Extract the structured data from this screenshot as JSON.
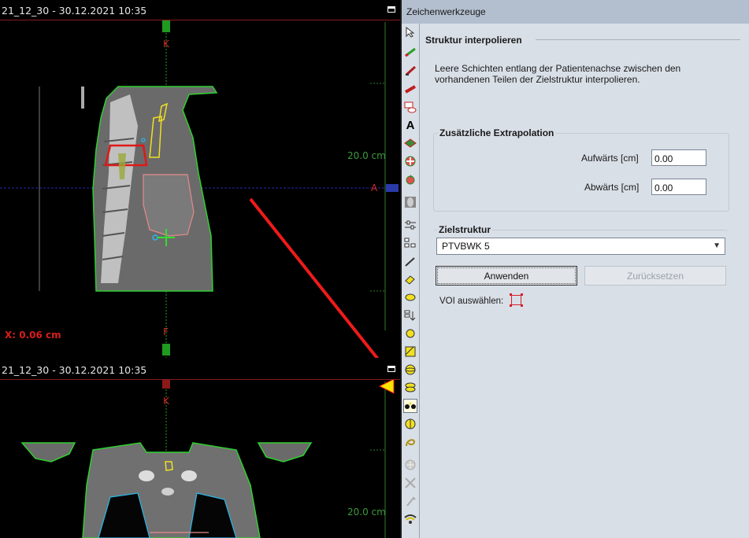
{
  "viewer_top": {
    "title": "21_12_30 - 30.12.2021 10:35",
    "orient_top": "K",
    "orient_right": "A",
    "orient_bottom": "F",
    "scale": "20.0 cm",
    "x_readout": "X: 0.06 cm"
  },
  "viewer_bottom": {
    "title": "21_12_30 - 30.12.2021 10:35",
    "orient_top": "K",
    "scale": "20.0 cm"
  },
  "panel": {
    "title": "Zeichenwerkzeuge",
    "section_title": "Struktur interpolieren",
    "description": "Leere Schichten entlang der Patientenachse zwischen den vorhandenen Teilen der Zielstruktur interpolieren.",
    "extrapolation": {
      "title": "Zusätzliche Extrapolation",
      "up_label": "Aufwärts [cm]",
      "up_value": "0.00",
      "down_label": "Abwärts [cm]",
      "down_value": "0.00"
    },
    "target": {
      "title": "Zielstruktur",
      "selected": "PTVBWK 5"
    },
    "apply_label": "Anwenden",
    "reset_label": "Zurücksetzen",
    "voi_label": "VOI auswählen:"
  },
  "toolbar_icons": [
    "pointer-icon",
    "pencil-green-icon",
    "brush-icon",
    "ruler-icon",
    "shape-cut-icon",
    "text-icon",
    "grid-3d-icon",
    "move-cross-icon",
    "rotate-icon",
    "image-thumb-icon",
    "settings-sliders-icon",
    "tree-structure-icon",
    "pen-icon",
    "eraser-icon",
    "yellow-shape-icon",
    "list-down-icon",
    "circle-icon",
    "hatch-icon",
    "sphere-icon",
    "stack-icon",
    "interpolate-icon",
    "globe-icon",
    "lasso-icon",
    "move-disabled-icon",
    "scissors-disabled-icon",
    "hook-disabled-icon",
    "wifi-icon"
  ],
  "colors": {
    "panel_bg": "#d9dfe7",
    "title_bar": "#b3bfce",
    "accent_red": "#d41f2a",
    "scale_green": "#3c9a3c",
    "contour_green": "#2fd02f",
    "annotation_arrow": "#ee1b1b",
    "pointer_yellow": "#f5e600"
  }
}
